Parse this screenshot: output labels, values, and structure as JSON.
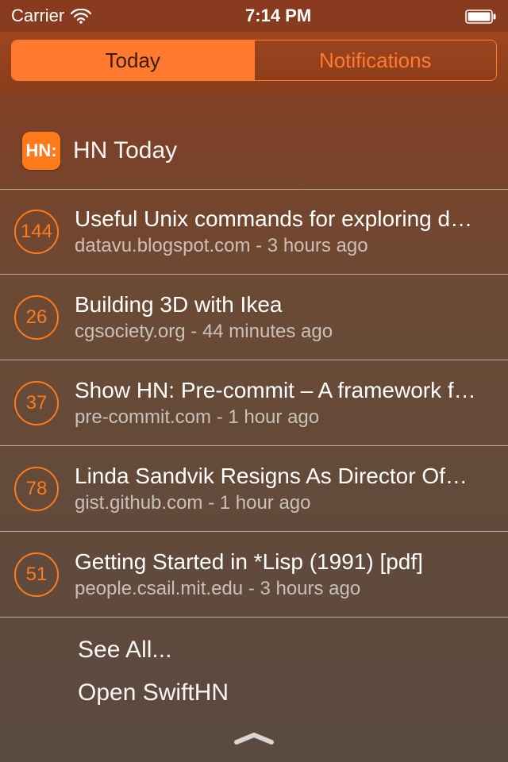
{
  "status": {
    "carrier": "Carrier",
    "time": "7:14 PM"
  },
  "tabs": {
    "today": "Today",
    "notifications": "Notifications"
  },
  "widget": {
    "icon_text": "HN:",
    "title": "HN Today",
    "see_all": "See All...",
    "open_app": "Open SwiftHN"
  },
  "stories": [
    {
      "score": "144",
      "title": "Useful Unix commands for exploring d…",
      "meta": "datavu.blogspot.com - 3 hours ago"
    },
    {
      "score": "26",
      "title": "Building 3D with Ikea",
      "meta": "cgsociety.org - 44 minutes ago"
    },
    {
      "score": "37",
      "title": "Show HN: Pre-commit – A framework f…",
      "meta": "pre-commit.com - 1 hour ago"
    },
    {
      "score": "78",
      "title": "Linda Sandvik Resigns As Director Of…",
      "meta": "gist.github.com - 1 hour ago"
    },
    {
      "score": "51",
      "title": "Getting Started in *Lisp (1991) [pdf]",
      "meta": "people.csail.mit.edu - 3 hours ago"
    }
  ],
  "colors": {
    "accent": "#ff7a1a"
  }
}
